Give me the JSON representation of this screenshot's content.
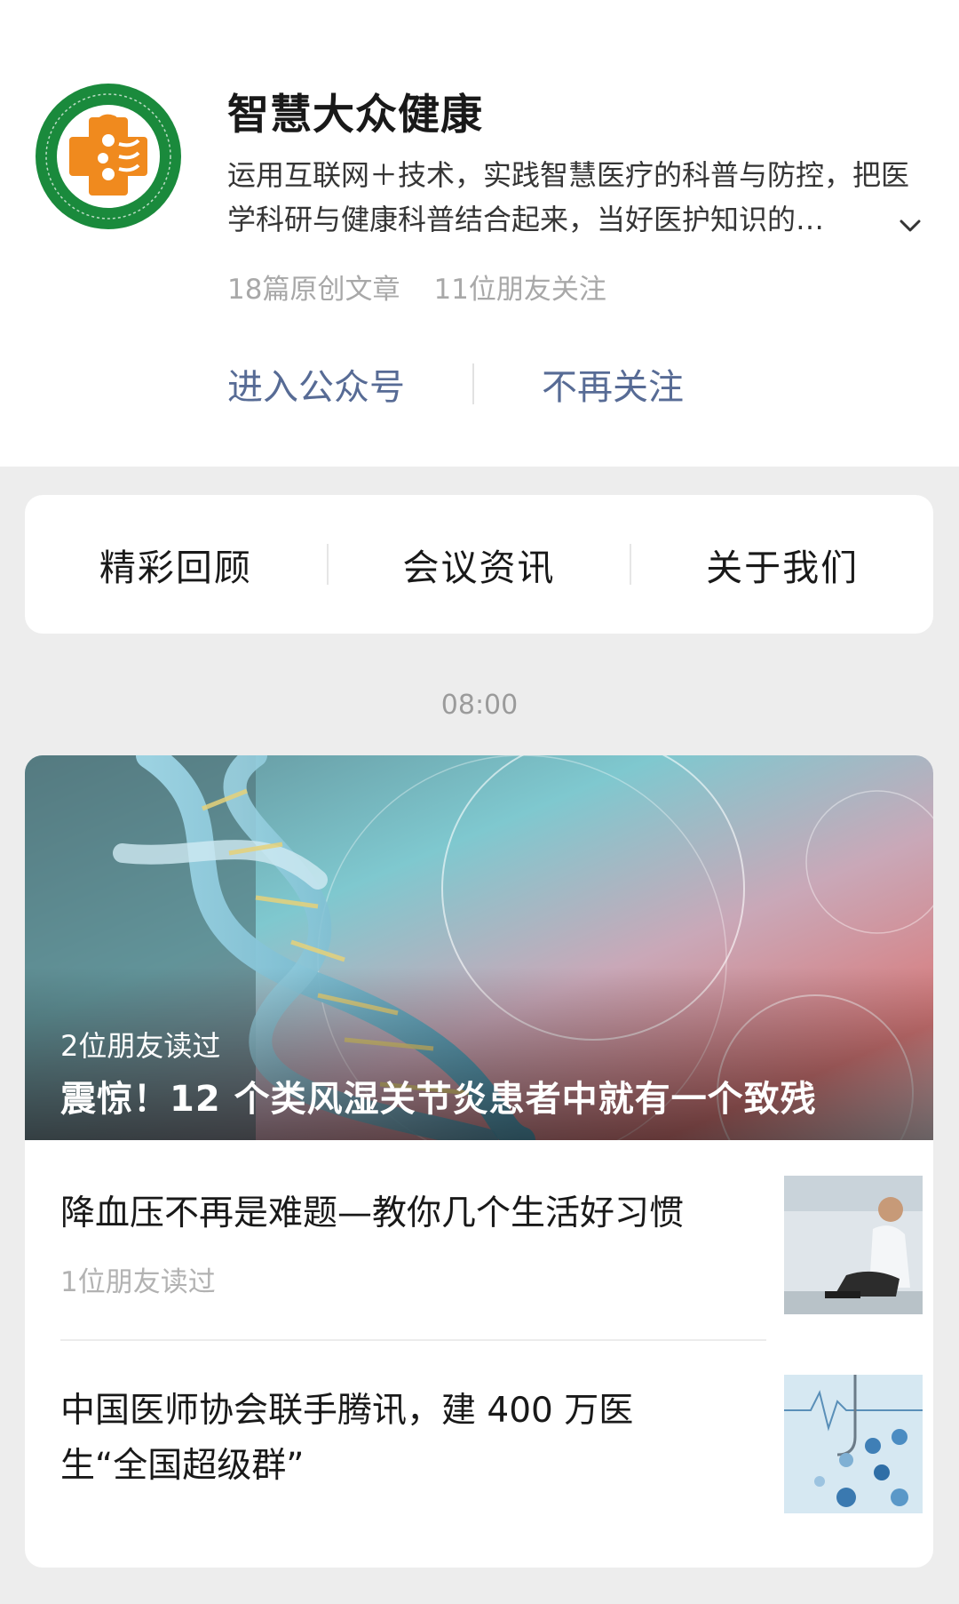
{
  "profile": {
    "name": "智慧大众健康",
    "description": "运用互联网＋技术，实践智慧医疗的科普与防控，把医学科研与健康科普结合起来，当好医护知识的…",
    "stats": {
      "articles": "18篇原创文章",
      "friends": "11位朋友关注"
    },
    "actions": {
      "enter": "进入公众号",
      "unfollow": "不再关注"
    },
    "logo_colors": {
      "ring": "#1a8a3c",
      "cross": "#f08a1e"
    }
  },
  "menu": {
    "items": [
      {
        "label": "精彩回顾"
      },
      {
        "label": "会议资讯"
      },
      {
        "label": "关于我们"
      }
    ]
  },
  "feed": {
    "timestamp": "08:00",
    "cover": {
      "friends": "2位朋友读过",
      "title": "震惊！12 个类风湿关节炎患者中就有一个致残"
    },
    "articles": [
      {
        "title": "降血压不再是难题—教你几个生活好习惯",
        "friends": "1位朋友读过"
      },
      {
        "title": "中国医师协会联手腾讯，建 400 万医生“全国超级群”",
        "friends": ""
      }
    ]
  },
  "colors": {
    "accent_link": "#576b95",
    "page_bg": "#ededed",
    "card_bg": "#ffffff"
  }
}
